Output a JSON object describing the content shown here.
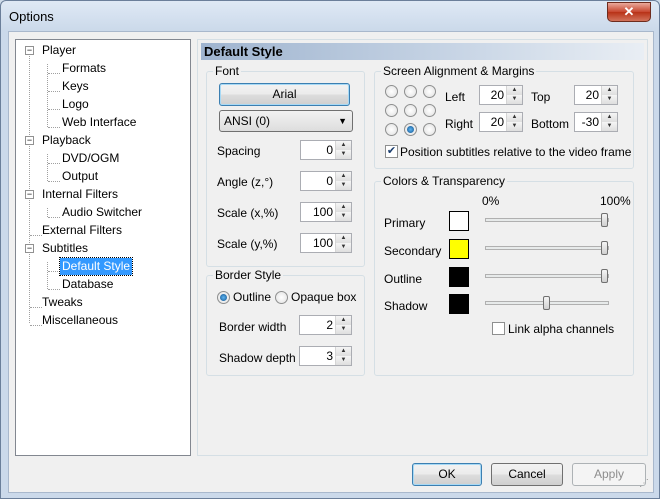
{
  "window": {
    "title": "Options",
    "close": "✕"
  },
  "tree": {
    "items": [
      {
        "label": "Player"
      },
      {
        "label": "Formats"
      },
      {
        "label": "Keys"
      },
      {
        "label": "Logo"
      },
      {
        "label": "Web Interface"
      },
      {
        "label": "Playback"
      },
      {
        "label": "DVD/OGM"
      },
      {
        "label": "Output"
      },
      {
        "label": "Internal Filters"
      },
      {
        "label": "Audio Switcher"
      },
      {
        "label": "External Filters"
      },
      {
        "label": "Subtitles"
      },
      {
        "label": "Default Style"
      },
      {
        "label": "Database"
      },
      {
        "label": "Tweaks"
      },
      {
        "label": "Miscellaneous"
      }
    ],
    "expander": "−"
  },
  "page": {
    "title": "Default Style"
  },
  "font": {
    "group_label": "Font",
    "font_button": "Arial",
    "charset": "ANSI (0)",
    "spacing_label": "Spacing",
    "spacing": "0",
    "angle_label": "Angle (z,°)",
    "angle": "0",
    "scalex_label": "Scale (x,%)",
    "scalex": "100",
    "scaley_label": "Scale (y,%)",
    "scaley": "100"
  },
  "border": {
    "group_label": "Border Style",
    "outline_label": "Outline",
    "opaque_label": "Opaque box",
    "width_label": "Border width",
    "width": "2",
    "shadow_label": "Shadow depth",
    "shadow": "3"
  },
  "alignment": {
    "group_label": "Screen Alignment & Margins",
    "left_label": "Left",
    "left": "20",
    "top_label": "Top",
    "top": "20",
    "right_label": "Right",
    "right": "20",
    "bottom_label": "Bottom",
    "bottom": "-30",
    "relative_label": "Position subtitles relative to the video frame",
    "relative_checked": true,
    "selected_position": "bottom-center"
  },
  "colors": {
    "group_label": "Colors & Transparency",
    "min_label": "0%",
    "max_label": "100%",
    "rows": [
      {
        "label": "Primary",
        "color": "#ffffff",
        "alpha": 1.0
      },
      {
        "label": "Secondary",
        "color": "#ffff00",
        "alpha": 1.0
      },
      {
        "label": "Outline",
        "color": "#000000",
        "alpha": 1.0
      },
      {
        "label": "Shadow",
        "color": "#000000",
        "alpha": 0.5
      }
    ],
    "link_label": "Link alpha channels",
    "link_checked": false
  },
  "buttons": {
    "ok": "OK",
    "cancel": "Cancel",
    "apply": "Apply"
  }
}
